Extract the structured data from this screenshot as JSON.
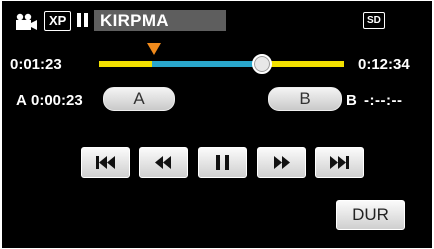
{
  "header": {
    "mode_icon": "video-camera-icon",
    "quality_badge": "XP",
    "playback_state_icon": "pause-icon",
    "clip_title": "KIRPMA",
    "media_badge": "SD"
  },
  "timeline": {
    "current_time": "0:01:23",
    "total_time": "0:12:34",
    "colors": {
      "track": "#f2e000",
      "selection": "#2aa7cc",
      "marker": "#f08a1c"
    }
  },
  "ab_repeat": {
    "a_label": "A",
    "a_time": "0:00:23",
    "a_button": "A",
    "b_button": "B",
    "b_label": "B",
    "b_time": "-:--:--"
  },
  "transport": {
    "buttons": [
      "skip-back-icon",
      "rewind-icon",
      "pause-icon",
      "fast-forward-icon",
      "skip-forward-icon"
    ]
  },
  "footer": {
    "dur_button": "DUR"
  }
}
